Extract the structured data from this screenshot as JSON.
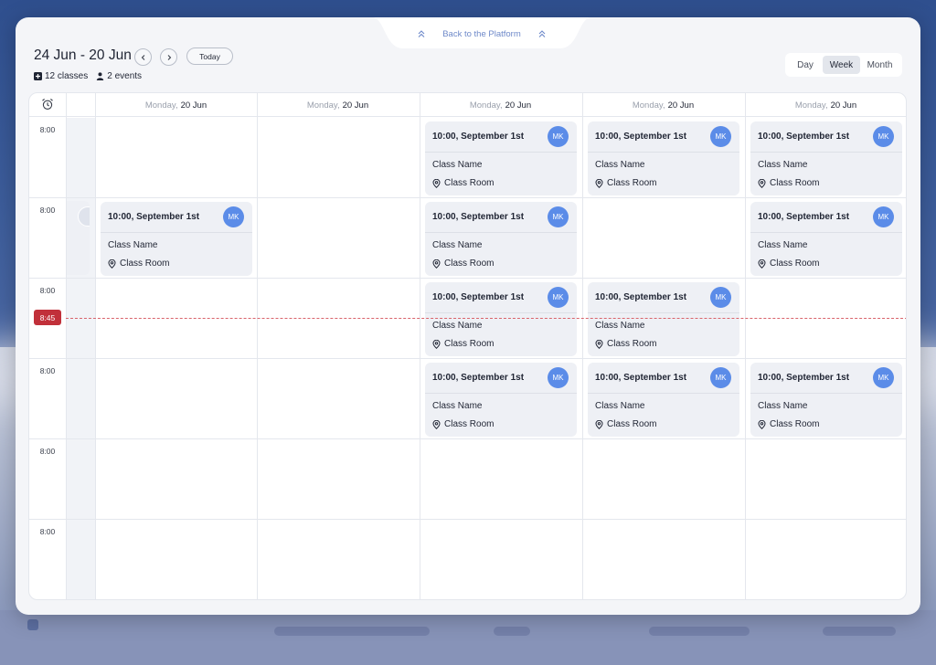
{
  "back_link": {
    "label": "Back to the Platform"
  },
  "header": {
    "date_range": "24 Jun - 20 Jun",
    "today_label": "Today",
    "classes_count": "12 classes",
    "events_count": "2 events"
  },
  "view_toggle": {
    "day": "Day",
    "week": "Week",
    "month": "Month",
    "active": "Week"
  },
  "columns": [
    {
      "day": "Monday,",
      "date": "20 Jun"
    },
    {
      "day": "Monday,",
      "date": "20 Jun"
    },
    {
      "day": "Monday,",
      "date": "20 Jun"
    },
    {
      "day": "Monday,",
      "date": "20 Jun"
    },
    {
      "day": "Monday,",
      "date": "20 Jun"
    }
  ],
  "time_slots": [
    "8:00",
    "8:00",
    "8:00",
    "8:00",
    "8:00",
    "8:00"
  ],
  "current_time": "8:45",
  "events": [
    {
      "time": "10:00, September 1st",
      "avatar": "MK",
      "name": "Class Name",
      "room": "Class Room",
      "col": 2,
      "row": 0
    },
    {
      "time": "10:00, September 1st",
      "avatar": "MK",
      "name": "Class Name",
      "room": "Class Room",
      "col": 3,
      "row": 0
    },
    {
      "time": "10:00, September 1st",
      "avatar": "MK",
      "name": "Class Name",
      "room": "Class Room",
      "col": 4,
      "row": 0
    },
    {
      "time": "10:00, September 1st",
      "avatar": "MK",
      "name": "Class Name",
      "room": "Class Room",
      "col": 0,
      "row": 1
    },
    {
      "time": "10:00, September 1st",
      "avatar": "MK",
      "name": "Class Name",
      "room": "Class Room",
      "col": 2,
      "row": 1
    },
    {
      "time": "10:00, September 1st",
      "avatar": "MK",
      "name": "Class Name",
      "room": "Class Room",
      "col": 4,
      "row": 1
    },
    {
      "time": "10:00, September 1st",
      "avatar": "MK",
      "name": "Class Name",
      "room": "Class Room",
      "col": 2,
      "row": 2
    },
    {
      "time": "10:00, September 1st",
      "avatar": "MK",
      "name": "Class Name",
      "room": "Class Room",
      "col": 3,
      "row": 2
    },
    {
      "time": "10:00, September 1st",
      "avatar": "MK",
      "name": "Class Name",
      "room": "Class Room",
      "col": 2,
      "row": 3
    },
    {
      "time": "10:00, September 1st",
      "avatar": "MK",
      "name": "Class Name",
      "room": "Class Room",
      "col": 3,
      "row": 3
    },
    {
      "time": "10:00, September 1st",
      "avatar": "MK",
      "name": "Class Name",
      "room": "Class Room",
      "col": 4,
      "row": 3
    }
  ],
  "icons": {
    "back": "double-chevron-up-icon",
    "prev": "chevron-left-icon",
    "next": "chevron-right-icon",
    "classes": "plus-square-icon",
    "events": "people-icon",
    "time_column": "alarm-clock-icon",
    "room": "location-pin-icon"
  },
  "colors": {
    "accent": "#6e89c9",
    "avatar": "#5b8ce8",
    "now_badge": "#c1303a",
    "now_line": "#d9636b",
    "event_bg": "#eef0f5"
  }
}
